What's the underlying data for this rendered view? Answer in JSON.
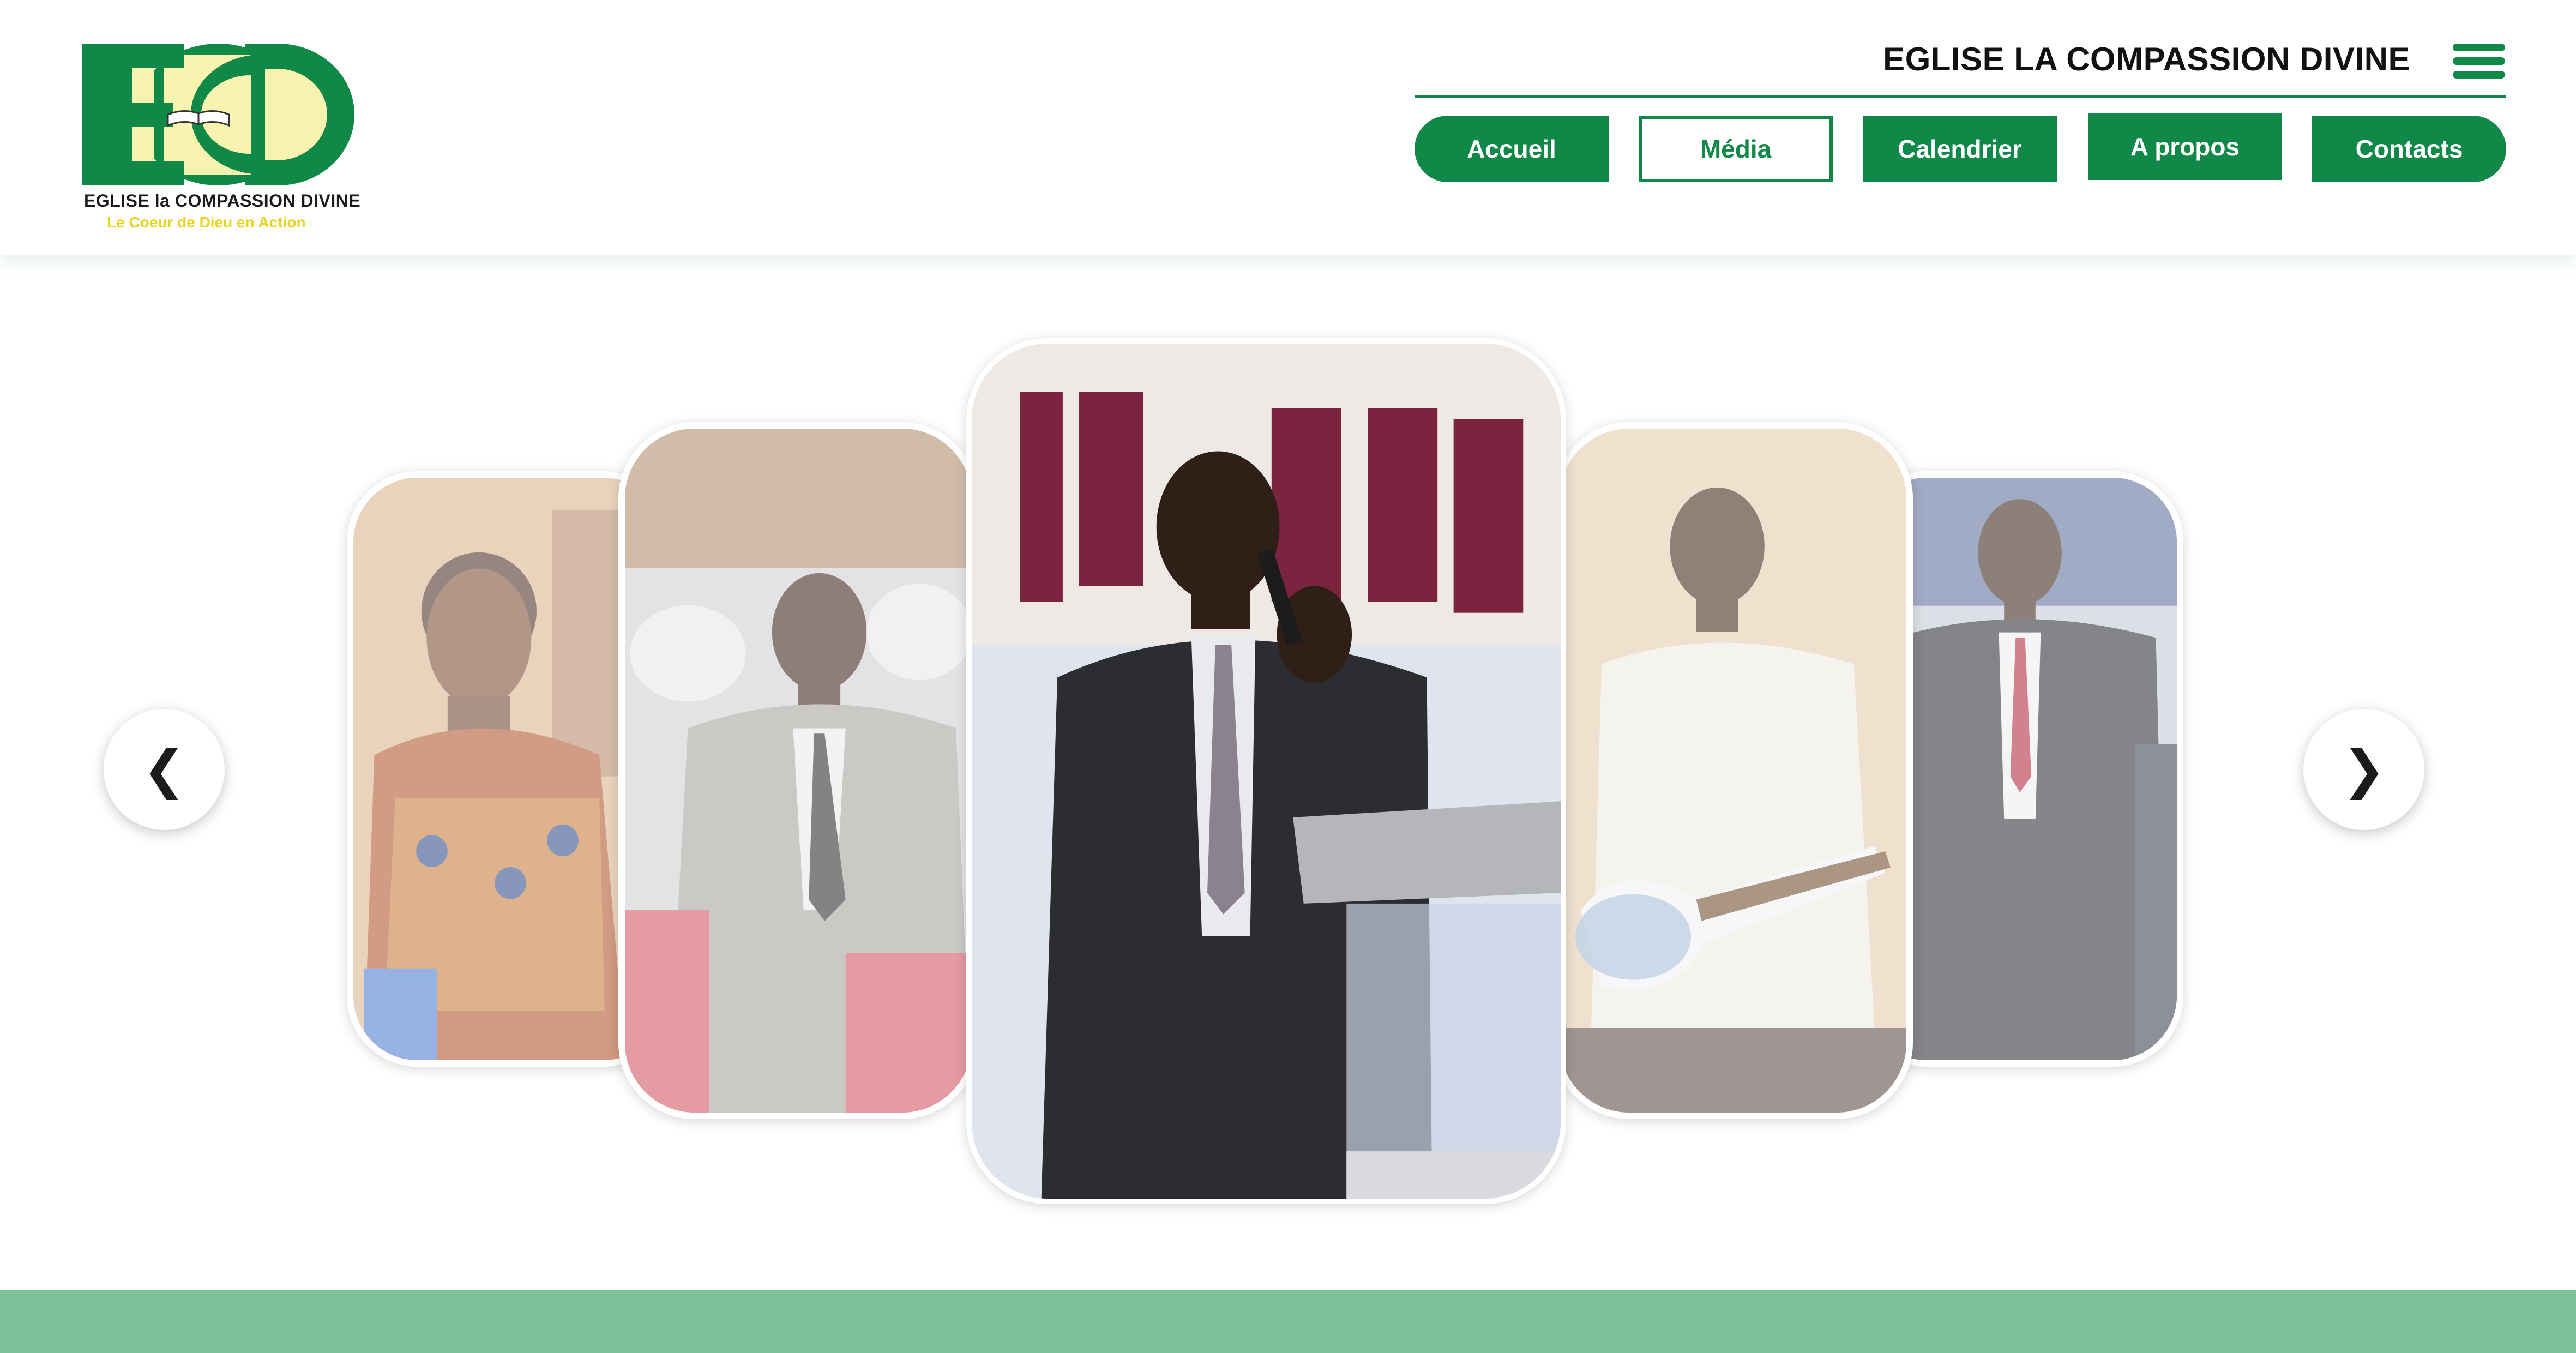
{
  "brand": {
    "logo_letters": "ECD",
    "logo_name": "EGLISE la COMPASSION DIVINE",
    "logo_tagline": "Le Coeur de Dieu en Action",
    "site_title": "EGLISE LA COMPASSION DIVINE",
    "colors": {
      "primary": "#108848",
      "accent": "#f8f4b0",
      "tagline": "#e8d21a",
      "footer": "#7dc39a"
    }
  },
  "header": {
    "menu_icon": "hamburger-menu-icon"
  },
  "nav": {
    "items": [
      {
        "label": "Accueil",
        "active": false
      },
      {
        "label": "Média",
        "active": true
      },
      {
        "label": "Calendrier",
        "active": false
      },
      {
        "label": "A propos",
        "active": false
      },
      {
        "label": "Contacts",
        "active": false
      }
    ]
  },
  "carousel": {
    "prev_icon": "chevron-left-icon",
    "next_icon": "chevron-right-icon",
    "prev_glyph": "❮",
    "next_glyph": "❯",
    "slides": [
      {
        "subject": "woman-in-patterned-dress-seated"
      },
      {
        "subject": "man-in-grey-suit-seated"
      },
      {
        "subject": "preacher-speaking-at-lectern",
        "active": true
      },
      {
        "subject": "young-man-playing-bass-guitar"
      },
      {
        "subject": "man-speaking-into-microphone"
      }
    ]
  }
}
